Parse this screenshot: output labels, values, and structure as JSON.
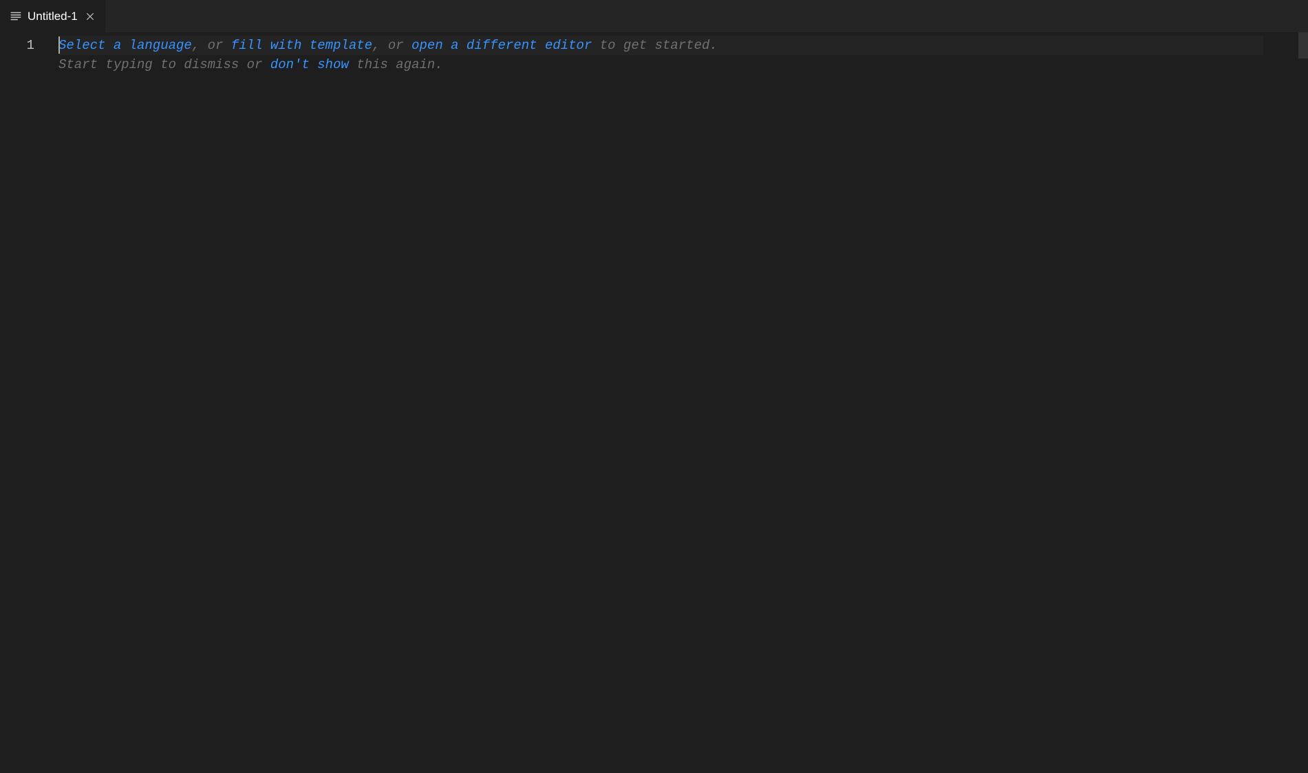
{
  "tab": {
    "label": "Untitled-1"
  },
  "gutter": {
    "line1": "1"
  },
  "hint": {
    "line1": {
      "link1": "Select a language",
      "sep1": ", or ",
      "link2": "fill with template",
      "sep2": ", or ",
      "link3": "open a different editor",
      "tail": " to get started."
    },
    "line2": {
      "pre": "Start typing to dismiss or ",
      "link": "don't show",
      "tail": " this again."
    }
  }
}
